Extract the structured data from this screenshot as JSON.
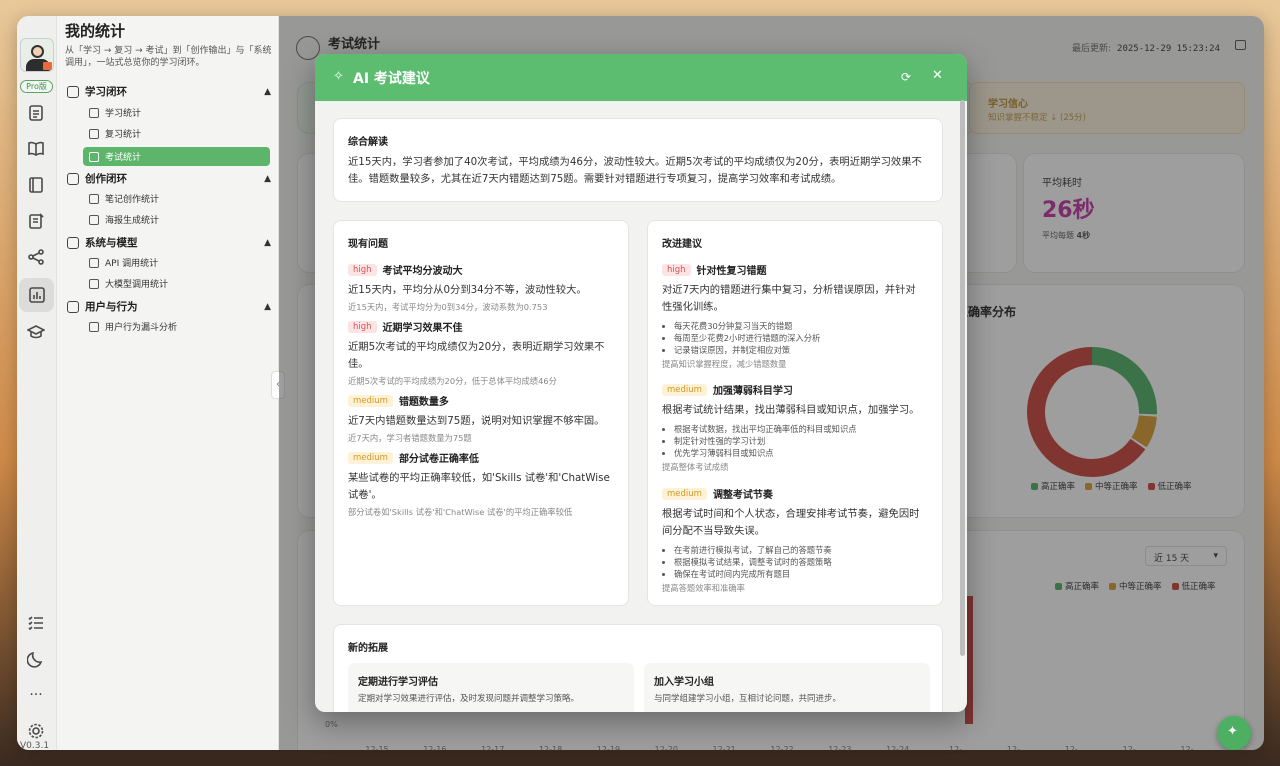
{
  "app": {
    "version": "V0.3.1",
    "pro_label": "Pro版"
  },
  "sidebar": {
    "title": "我的统计",
    "subtitle": "从「学习 → 复习 → 考试」到「创作输出」与「系统调用」，一站式总览你的学习闭环。",
    "sections": [
      {
        "label": "学习闭环",
        "items": [
          "学习统计",
          "复习统计",
          "考试统计"
        ]
      },
      {
        "label": "创作闭环",
        "items": [
          "笔记创作统计",
          "海报生成统计"
        ]
      },
      {
        "label": "系统与模型",
        "items": [
          "API 调用统计",
          "大模型调用统计"
        ]
      },
      {
        "label": "用户与行为",
        "items": [
          "用户行为漏斗分析"
        ]
      }
    ]
  },
  "main": {
    "title": "考试统计",
    "last_update_label": "最后更新:",
    "last_update_value": "2025-12-29 15:23:24",
    "confidence": {
      "title": "学习信心",
      "sub": "知识掌握不稳定 ↓ (25分)"
    },
    "avg_time": {
      "label": "平均耗时",
      "value": "26秒",
      "sub_label": "平均每题",
      "sub_value": "4秒"
    },
    "distribution": {
      "title": "正确率分布",
      "legend": [
        "高正确率",
        "中等正确率",
        "低正确率"
      ]
    },
    "trend": {
      "range": "近 15 天",
      "legend": [
        "高正确率",
        "中等正确率",
        "低正确率"
      ],
      "y_zero": "0%",
      "x_ticks": [
        "12-15",
        "12-16",
        "12-17",
        "12-18",
        "12-19",
        "12-20",
        "12-21",
        "12-22",
        "12-23",
        "12-24",
        "12-25",
        "12-26",
        "12-27",
        "12-28",
        "12-29"
      ]
    }
  },
  "colors": {
    "high": "#4caf62",
    "medium": "#d99a2b",
    "low": "#c9403a",
    "accent": "#5cbd71"
  },
  "modal": {
    "title": "AI 考试建议",
    "summary": {
      "title": "综合解读",
      "text": "近15天内，学习者参加了40次考试，平均成绩为46分，波动性较大。近期5次考试的平均成绩仅为20分，表明近期学习效果不佳。错题数量较多，尤其在近7天内错题达到75题。需要针对错题进行专项复习，提高学习效率和考试成绩。"
    },
    "issues": {
      "title": "现有问题",
      "items": [
        {
          "level": "high",
          "title": "考试平均分波动大",
          "desc": "近15天内，平均分从0分到34分不等，波动性较大。",
          "note": "近15天内，考试平均分为0到34分，波动系数为0.753"
        },
        {
          "level": "high",
          "title": "近期学习效果不佳",
          "desc": "近期5次考试的平均成绩仅为20分，表明近期学习效果不佳。",
          "note": "近期5次考试的平均成绩为20分，低于总体平均成绩46分"
        },
        {
          "level": "medium",
          "title": "错题数量多",
          "desc": "近7天内错题数量达到75题，说明对知识掌握不够牢固。",
          "note": "近7天内，学习者错题数量为75题"
        },
        {
          "level": "medium",
          "title": "部分试卷正确率低",
          "desc": "某些试卷的平均正确率较低，如'Skills 试卷'和'ChatWise 试卷'。",
          "note": "部分试卷如'Skills 试卷'和'ChatWise 试卷'的平均正确率较低"
        }
      ]
    },
    "suggestions": {
      "title": "改进建议",
      "items": [
        {
          "level": "high",
          "title": "针对性复习错题",
          "desc": "对近7天内的错题进行集中复习，分析错误原因，并针对性强化训练。",
          "bullets": [
            "每天花费30分钟复习当天的错题",
            "每周至少花费2小时进行错题的深入分析",
            "记录错误原因，并制定相应对策"
          ],
          "note": "提高知识掌握程度，减少错题数量"
        },
        {
          "level": "medium",
          "title": "加强薄弱科目学习",
          "desc": "根据考试统计结果，找出薄弱科目或知识点，加强学习。",
          "bullets": [
            "根据考试数据，找出平均正确率低的科目或知识点",
            "制定针对性强的学习计划",
            "优先学习薄弱科目或知识点"
          ],
          "note": "提高整体考试成绩"
        },
        {
          "level": "medium",
          "title": "调整考试节奏",
          "desc": "根据考试时间和个人状态，合理安排考试节奏，避免因时间分配不当导致失误。",
          "bullets": [
            "在考前进行模拟考试，了解自己的答题节奏",
            "根据模拟考试结果，调整考试时的答题策略",
            "确保在考试时间内完成所有题目"
          ],
          "note": "提高答题效率和准确率"
        }
      ]
    },
    "extensions": {
      "title": "新的拓展",
      "items": [
        {
          "title": "定期进行学习评估",
          "desc": "定期对学习效果进行评估，及时发现问题并调整学习策略。"
        },
        {
          "title": "加入学习小组",
          "desc": "与同学组建学习小组，互相讨论问题，共同进步。"
        }
      ]
    }
  }
}
